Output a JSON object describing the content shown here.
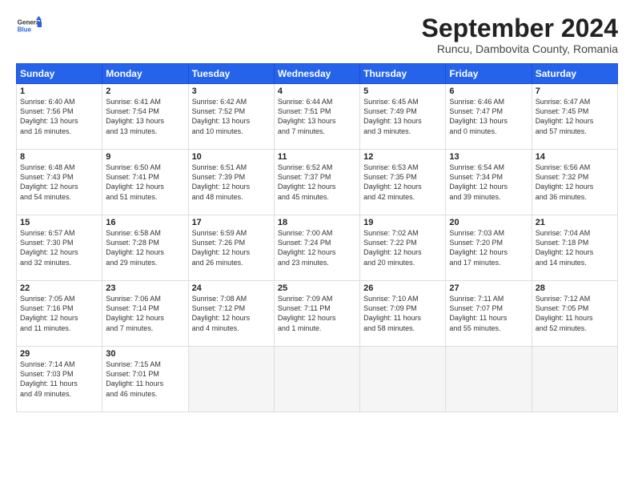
{
  "header": {
    "logo_general": "General",
    "logo_blue": "Blue",
    "month_title": "September 2024",
    "subtitle": "Runcu, Dambovita County, Romania"
  },
  "days_of_week": [
    "Sunday",
    "Monday",
    "Tuesday",
    "Wednesday",
    "Thursday",
    "Friday",
    "Saturday"
  ],
  "weeks": [
    [
      {
        "num": "1",
        "detail": "Sunrise: 6:40 AM\nSunset: 7:56 PM\nDaylight: 13 hours\nand 16 minutes."
      },
      {
        "num": "2",
        "detail": "Sunrise: 6:41 AM\nSunset: 7:54 PM\nDaylight: 13 hours\nand 13 minutes."
      },
      {
        "num": "3",
        "detail": "Sunrise: 6:42 AM\nSunset: 7:52 PM\nDaylight: 13 hours\nand 10 minutes."
      },
      {
        "num": "4",
        "detail": "Sunrise: 6:44 AM\nSunset: 7:51 PM\nDaylight: 13 hours\nand 7 minutes."
      },
      {
        "num": "5",
        "detail": "Sunrise: 6:45 AM\nSunset: 7:49 PM\nDaylight: 13 hours\nand 3 minutes."
      },
      {
        "num": "6",
        "detail": "Sunrise: 6:46 AM\nSunset: 7:47 PM\nDaylight: 13 hours\nand 0 minutes."
      },
      {
        "num": "7",
        "detail": "Sunrise: 6:47 AM\nSunset: 7:45 PM\nDaylight: 12 hours\nand 57 minutes."
      }
    ],
    [
      {
        "num": "8",
        "detail": "Sunrise: 6:48 AM\nSunset: 7:43 PM\nDaylight: 12 hours\nand 54 minutes."
      },
      {
        "num": "9",
        "detail": "Sunrise: 6:50 AM\nSunset: 7:41 PM\nDaylight: 12 hours\nand 51 minutes."
      },
      {
        "num": "10",
        "detail": "Sunrise: 6:51 AM\nSunset: 7:39 PM\nDaylight: 12 hours\nand 48 minutes."
      },
      {
        "num": "11",
        "detail": "Sunrise: 6:52 AM\nSunset: 7:37 PM\nDaylight: 12 hours\nand 45 minutes."
      },
      {
        "num": "12",
        "detail": "Sunrise: 6:53 AM\nSunset: 7:35 PM\nDaylight: 12 hours\nand 42 minutes."
      },
      {
        "num": "13",
        "detail": "Sunrise: 6:54 AM\nSunset: 7:34 PM\nDaylight: 12 hours\nand 39 minutes."
      },
      {
        "num": "14",
        "detail": "Sunrise: 6:56 AM\nSunset: 7:32 PM\nDaylight: 12 hours\nand 36 minutes."
      }
    ],
    [
      {
        "num": "15",
        "detail": "Sunrise: 6:57 AM\nSunset: 7:30 PM\nDaylight: 12 hours\nand 32 minutes."
      },
      {
        "num": "16",
        "detail": "Sunrise: 6:58 AM\nSunset: 7:28 PM\nDaylight: 12 hours\nand 29 minutes."
      },
      {
        "num": "17",
        "detail": "Sunrise: 6:59 AM\nSunset: 7:26 PM\nDaylight: 12 hours\nand 26 minutes."
      },
      {
        "num": "18",
        "detail": "Sunrise: 7:00 AM\nSunset: 7:24 PM\nDaylight: 12 hours\nand 23 minutes."
      },
      {
        "num": "19",
        "detail": "Sunrise: 7:02 AM\nSunset: 7:22 PM\nDaylight: 12 hours\nand 20 minutes."
      },
      {
        "num": "20",
        "detail": "Sunrise: 7:03 AM\nSunset: 7:20 PM\nDaylight: 12 hours\nand 17 minutes."
      },
      {
        "num": "21",
        "detail": "Sunrise: 7:04 AM\nSunset: 7:18 PM\nDaylight: 12 hours\nand 14 minutes."
      }
    ],
    [
      {
        "num": "22",
        "detail": "Sunrise: 7:05 AM\nSunset: 7:16 PM\nDaylight: 12 hours\nand 11 minutes."
      },
      {
        "num": "23",
        "detail": "Sunrise: 7:06 AM\nSunset: 7:14 PM\nDaylight: 12 hours\nand 7 minutes."
      },
      {
        "num": "24",
        "detail": "Sunrise: 7:08 AM\nSunset: 7:12 PM\nDaylight: 12 hours\nand 4 minutes."
      },
      {
        "num": "25",
        "detail": "Sunrise: 7:09 AM\nSunset: 7:11 PM\nDaylight: 12 hours\nand 1 minute."
      },
      {
        "num": "26",
        "detail": "Sunrise: 7:10 AM\nSunset: 7:09 PM\nDaylight: 11 hours\nand 58 minutes."
      },
      {
        "num": "27",
        "detail": "Sunrise: 7:11 AM\nSunset: 7:07 PM\nDaylight: 11 hours\nand 55 minutes."
      },
      {
        "num": "28",
        "detail": "Sunrise: 7:12 AM\nSunset: 7:05 PM\nDaylight: 11 hours\nand 52 minutes."
      }
    ],
    [
      {
        "num": "29",
        "detail": "Sunrise: 7:14 AM\nSunset: 7:03 PM\nDaylight: 11 hours\nand 49 minutes."
      },
      {
        "num": "30",
        "detail": "Sunrise: 7:15 AM\nSunset: 7:01 PM\nDaylight: 11 hours\nand 46 minutes."
      },
      {
        "num": "",
        "detail": ""
      },
      {
        "num": "",
        "detail": ""
      },
      {
        "num": "",
        "detail": ""
      },
      {
        "num": "",
        "detail": ""
      },
      {
        "num": "",
        "detail": ""
      }
    ]
  ]
}
